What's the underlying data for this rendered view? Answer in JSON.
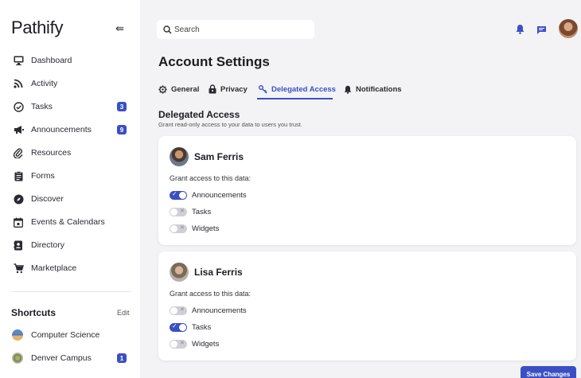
{
  "app": {
    "logo": "Pathify"
  },
  "sidebar": {
    "items": [
      {
        "label": "Dashboard",
        "icon": "monitor-icon"
      },
      {
        "label": "Activity",
        "icon": "rss-icon"
      },
      {
        "label": "Tasks",
        "icon": "check-circle-icon",
        "badge": "3"
      },
      {
        "label": "Announcements",
        "icon": "megaphone-icon",
        "badge": "9"
      },
      {
        "label": "Resources",
        "icon": "paperclip-icon"
      },
      {
        "label": "Forms",
        "icon": "clipboard-icon"
      },
      {
        "label": "Discover",
        "icon": "compass-icon"
      },
      {
        "label": "Events & Calendars",
        "icon": "calendar-icon"
      },
      {
        "label": "Directory",
        "icon": "contacts-icon"
      },
      {
        "label": "Marketplace",
        "icon": "cart-icon"
      }
    ],
    "shortcuts": {
      "title": "Shortcuts",
      "edit": "Edit",
      "items": [
        {
          "label": "Computer Science"
        },
        {
          "label": "Denver Campus",
          "badge": "1"
        }
      ]
    }
  },
  "search": {
    "placeholder": "Search"
  },
  "page": {
    "title": "Account Settings",
    "tabs": [
      {
        "label": "General",
        "icon": "gear-icon"
      },
      {
        "label": "Privacy",
        "icon": "lock-icon"
      },
      {
        "label": "Delegated Access",
        "icon": "key-icon",
        "active": true
      },
      {
        "label": "Notifications",
        "icon": "bell-icon"
      }
    ],
    "section": {
      "title": "Delegated Access",
      "description": "Grant read-only access to your data to users you trust."
    },
    "cards": [
      {
        "name": "Sam Ferris",
        "grant_label": "Grant access to this data:",
        "permissions": [
          {
            "label": "Announcements",
            "enabled": true
          },
          {
            "label": "Tasks",
            "enabled": false
          },
          {
            "label": "Widgets",
            "enabled": false
          }
        ]
      },
      {
        "name": "Lisa Ferris",
        "grant_label": "Grant access to this data:",
        "permissions": [
          {
            "label": "Announcements",
            "enabled": false
          },
          {
            "label": "Tasks",
            "enabled": true
          },
          {
            "label": "Widgets",
            "enabled": false
          }
        ]
      }
    ],
    "save_label": "Save Changes"
  },
  "colors": {
    "accent": "#3b4fc4",
    "background": "#f3f3f5"
  }
}
